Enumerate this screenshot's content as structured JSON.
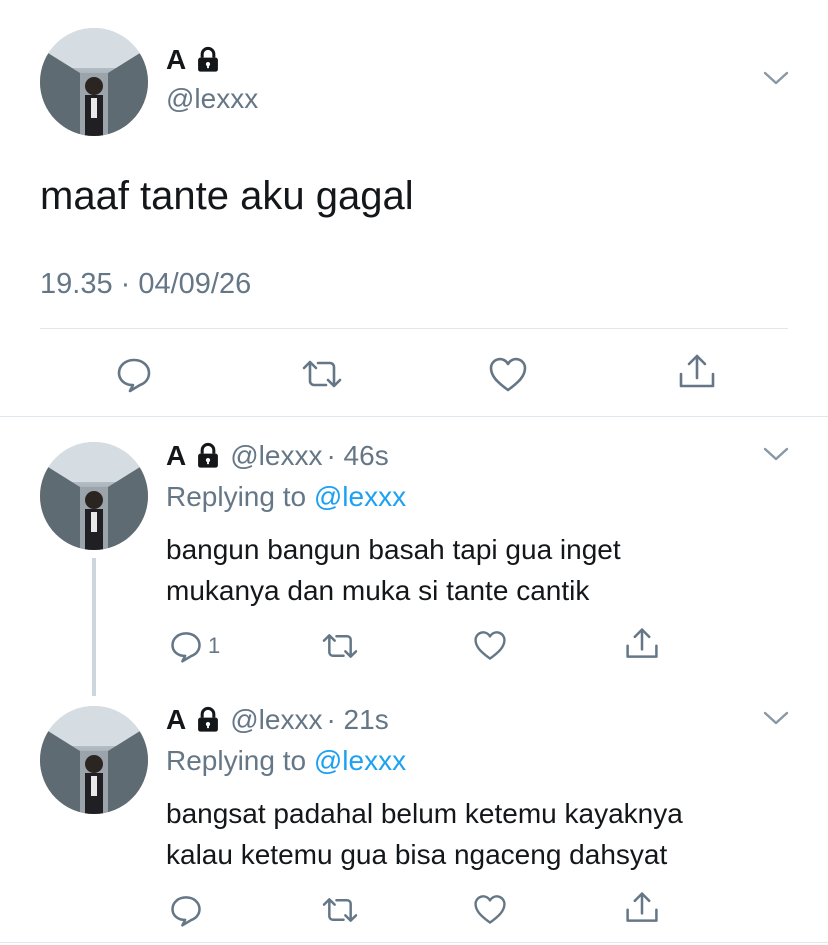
{
  "main_tweet": {
    "name": "A",
    "handle": "@lexxx",
    "text": "maaf tante aku gagal",
    "timestamp": "19.35 · 04/09/26"
  },
  "replies": [
    {
      "name": "A",
      "handle": "@lexxx",
      "age": "· 46s",
      "replying_prefix": "Replying to",
      "replying_to": "@lexxx",
      "line1": "bangun bangun basah tapi gua inget",
      "line2": "mukanya dan muka si tante cantik",
      "reply_count": "1"
    },
    {
      "name": "A",
      "handle": "@lexxx",
      "age": "· 21s",
      "replying_prefix": "Replying to",
      "replying_to": "@lexxx",
      "line1": "bangsat padahal belum ketemu kayaknya",
      "line2": "kalau ketemu gua bisa ngaceng dahsyat",
      "reply_count": ""
    }
  ],
  "icons": [
    "lock-icon",
    "chevron-down-icon",
    "reply-icon",
    "retweet-icon",
    "like-icon",
    "share-icon"
  ],
  "colors": {
    "accent": "#1da1f2",
    "secondary": "#657786",
    "text": "#14171a",
    "divider": "#e1e8ed"
  }
}
